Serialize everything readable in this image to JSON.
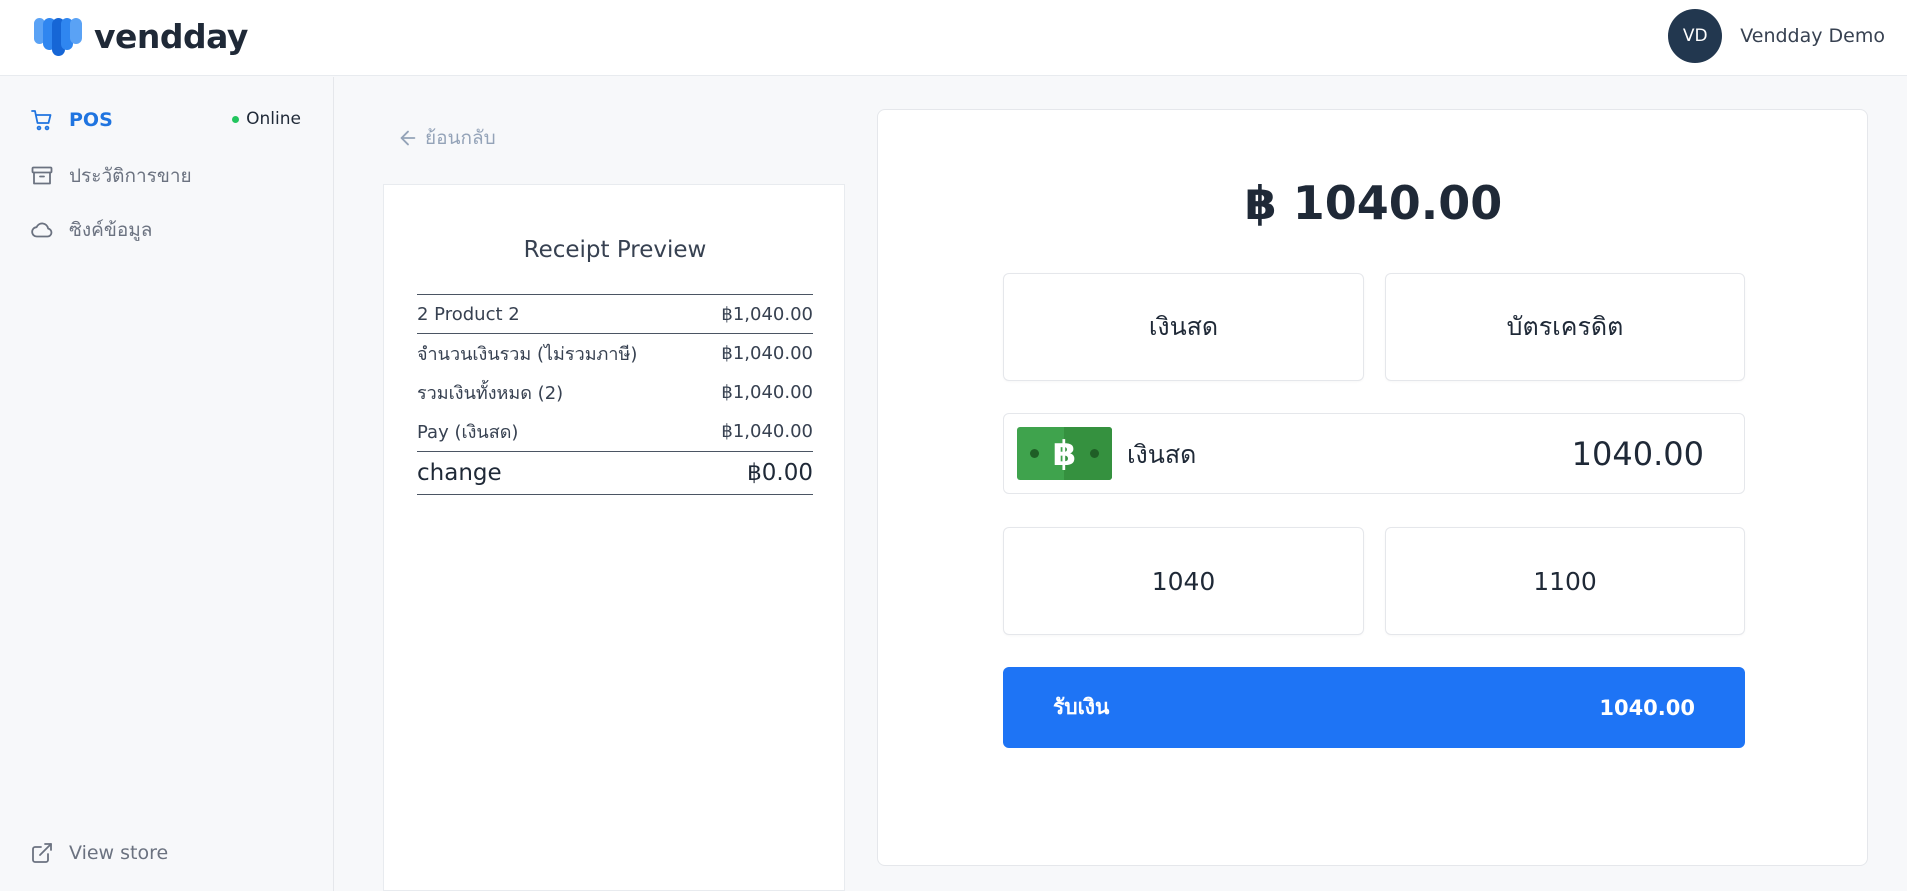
{
  "header": {
    "brand": "vendday",
    "user_initials": "VD",
    "user_name": "Vendday Demo"
  },
  "sidebar": {
    "items": [
      {
        "label": "POS",
        "icon": "cart-icon"
      },
      {
        "label": "ประวัติการขาย",
        "icon": "archive-icon"
      },
      {
        "label": "ซิงค์ข้อมูล",
        "icon": "cloud-icon"
      }
    ],
    "status": "Online",
    "view_store": "View store"
  },
  "back_label": "ย้อนกลับ",
  "receipt": {
    "title": "Receipt Preview",
    "rows": [
      {
        "label": "2 Product 2",
        "value": "฿1,040.00"
      },
      {
        "label": "จำนวนเงินรวม (ไม่รวมภาษี)",
        "value": "฿1,040.00"
      },
      {
        "label": "รวมเงินทั้งหมด (2)",
        "value": "฿1,040.00"
      },
      {
        "label": "Pay (เงินสด)",
        "value": "฿1,040.00"
      },
      {
        "label": "change",
        "value": "฿0.00"
      }
    ]
  },
  "payment": {
    "total": "฿ 1040.00",
    "methods": [
      "เงินสด",
      "บัตรเครดิต"
    ],
    "cash_label": "เงินสด",
    "cash_value": "1040.00",
    "quick_amounts": [
      "1040",
      "1100"
    ],
    "receive_label": "รับเงิน",
    "receive_amount": "1040.00"
  },
  "colors": {
    "accent": "#1e74f5",
    "online": "#22c55e",
    "avatar": "#22374f",
    "bill": "#3fa34d"
  }
}
